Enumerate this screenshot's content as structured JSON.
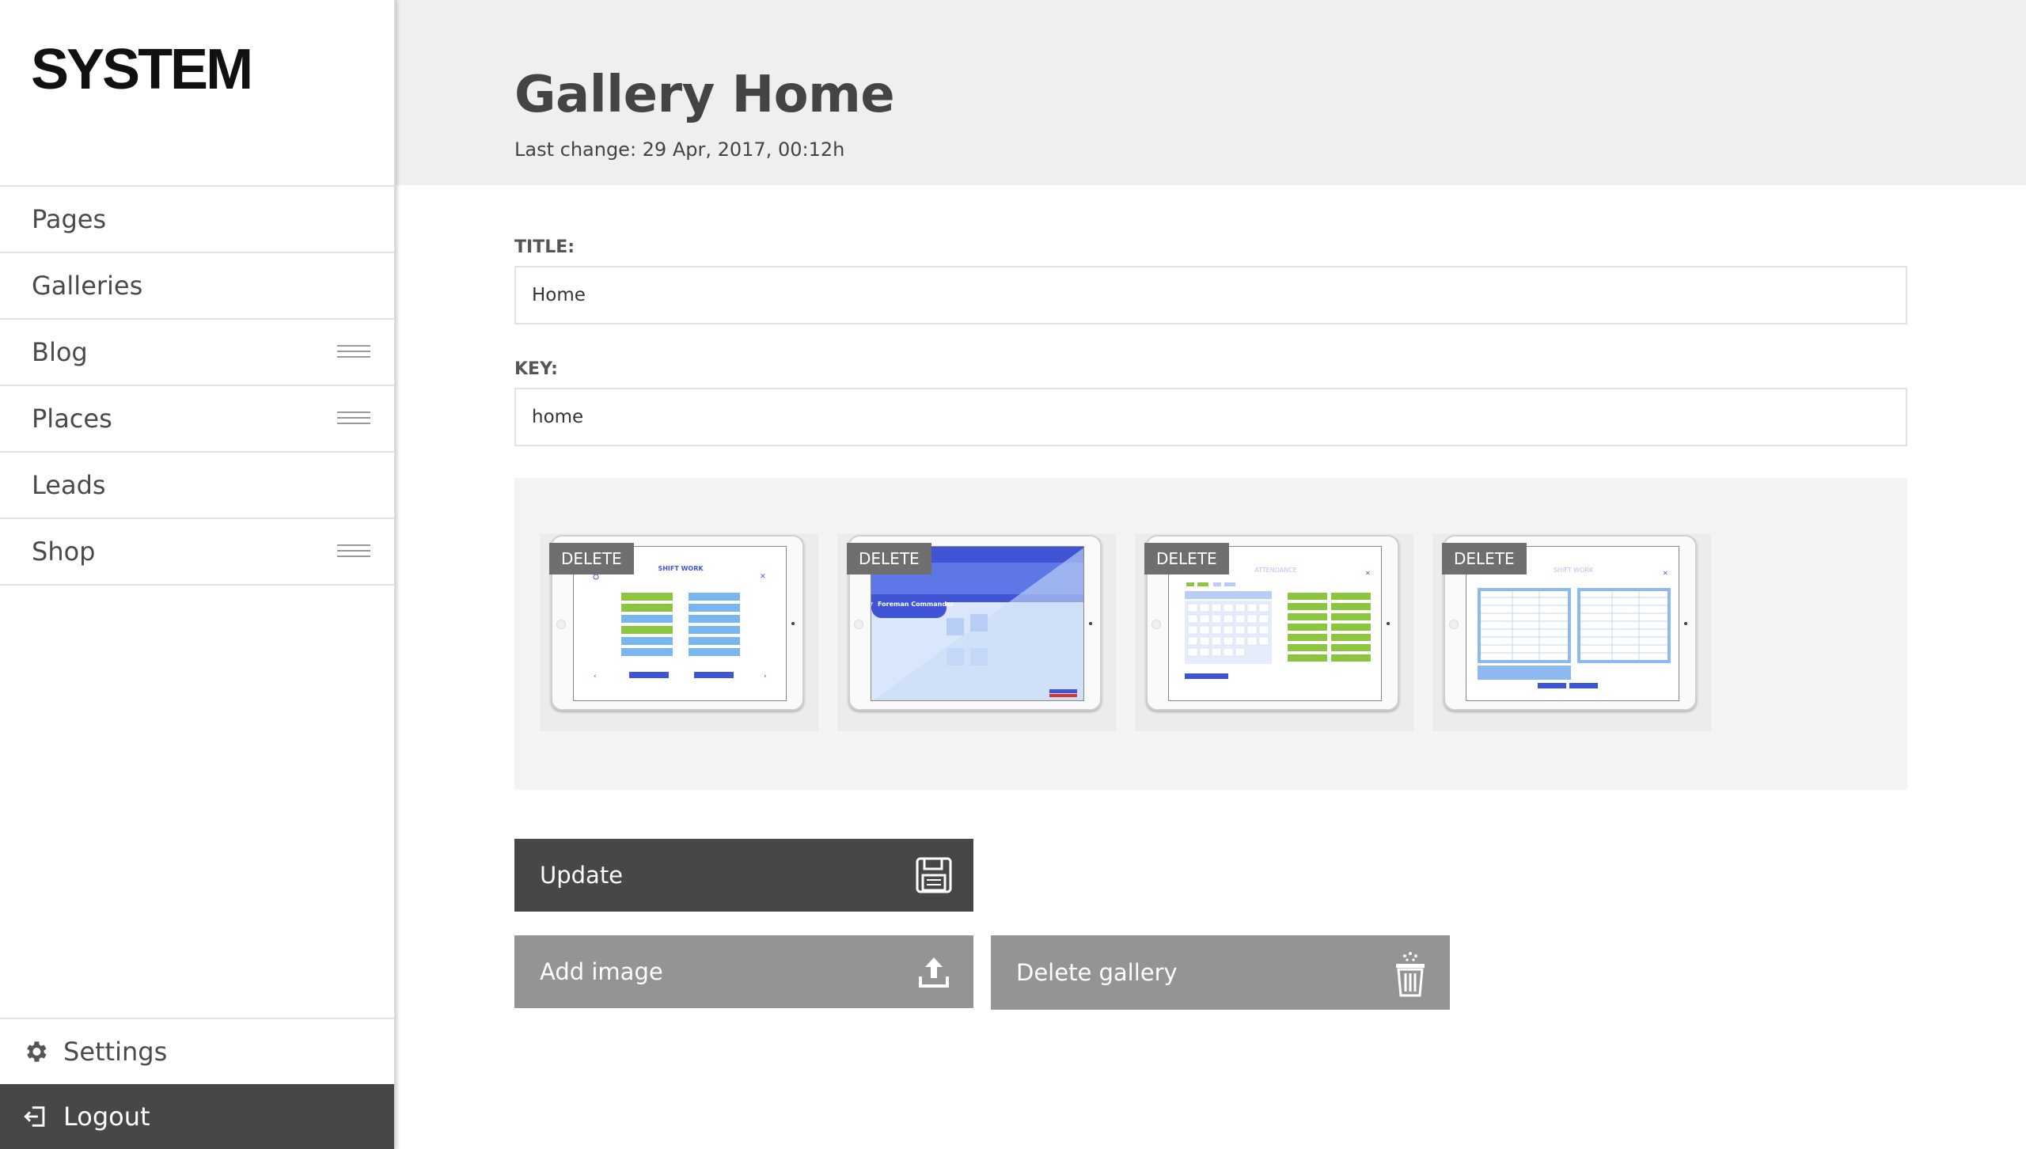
{
  "sidebar": {
    "logo": "SYSTEM",
    "items": [
      {
        "label": "Pages",
        "has_submenu": false
      },
      {
        "label": "Galleries",
        "has_submenu": false
      },
      {
        "label": "Blog",
        "has_submenu": true
      },
      {
        "label": "Places",
        "has_submenu": true
      },
      {
        "label": "Leads",
        "has_submenu": false
      },
      {
        "label": "Shop",
        "has_submenu": true
      }
    ],
    "settings_label": "Settings",
    "logout_label": "Logout"
  },
  "header": {
    "title": "Gallery Home",
    "last_change": "Last change: 29 Apr, 2017, 00:12h"
  },
  "form": {
    "title_label": "TITLE:",
    "title_value": "Home",
    "key_label": "KEY:",
    "key_value": "home"
  },
  "gallery": {
    "images": [
      {
        "delete_label": "DELETE",
        "screen_title": "SHIFT WORK"
      },
      {
        "delete_label": "DELETE",
        "screen_title": "Foreman Commander"
      },
      {
        "delete_label": "DELETE",
        "screen_title": "ATTENDANCE"
      },
      {
        "delete_label": "DELETE",
        "screen_title": "SHIFT WORK"
      }
    ]
  },
  "buttons": {
    "update_label": "Update",
    "add_image_label": "Add image",
    "delete_gallery_label": "Delete gallery"
  },
  "colors": {
    "accent_blue": "#3f55d6",
    "accent_green": "#8cc63f",
    "dark_button": "#474747",
    "grey_button": "#949494"
  },
  "icons": [
    "hamburger-icon",
    "gear-icon",
    "logout-icon",
    "floppy-disk-icon",
    "upload-icon",
    "trash-icon"
  ]
}
